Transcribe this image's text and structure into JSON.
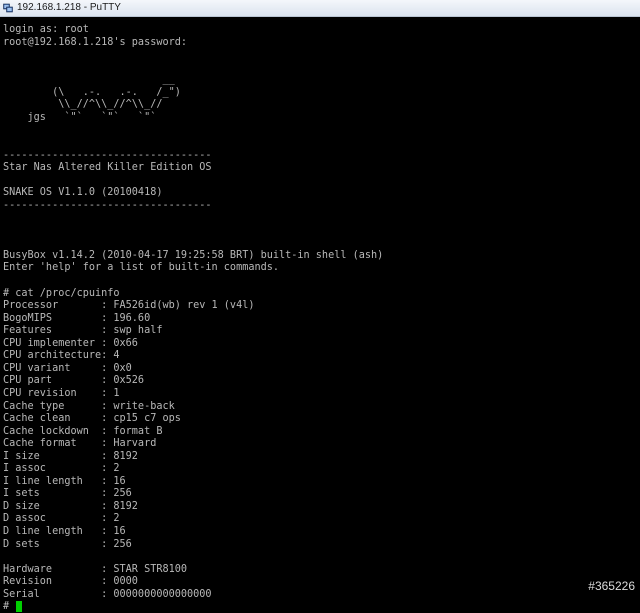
{
  "window": {
    "title": "192.168.1.218 - PuTTY",
    "app_icon": "putty-icon"
  },
  "terminal": {
    "lines": [
      "login as: root",
      "root@192.168.1.218's password:",
      "",
      "",
      "                          __",
      "        (\\   .-.   .-.   /_\")",
      "         \\\\_//^\\\\_//^\\\\_//",
      "    jgs   `\"`   `\"`   `\"`",
      "",
      "",
      "----------------------------------",
      "Star Nas Altered Killer Edition OS",
      "",
      "SNAKE OS V1.1.0 (20100418)",
      "----------------------------------",
      "",
      "",
      "",
      "BusyBox v1.14.2 (2010-04-17 19:25:58 BRT) built-in shell (ash)",
      "Enter 'help' for a list of built-in commands.",
      "",
      "# cat /proc/cpuinfo",
      "Processor       : FA526id(wb) rev 1 (v4l)",
      "BogoMIPS        : 196.60",
      "Features        : swp half",
      "CPU implementer : 0x66",
      "CPU architecture: 4",
      "CPU variant     : 0x0",
      "CPU part        : 0x526",
      "CPU revision    : 1",
      "Cache type      : write-back",
      "Cache clean     : cp15 c7 ops",
      "Cache lockdown  : format B",
      "Cache format    : Harvard",
      "I size          : 8192",
      "I assoc         : 2",
      "I line length   : 16",
      "I sets          : 256",
      "D size          : 8192",
      "D assoc         : 2",
      "D line length   : 16",
      "D sets          : 256",
      "",
      "Hardware        : STAR STR8100",
      "Revision        : 0000",
      "Serial          : 0000000000000000"
    ],
    "prompt": "# ",
    "cursor_color": "#00d000",
    "text_color": "#b8b8b8",
    "background_color": "#000000"
  },
  "watermark": "#365226"
}
